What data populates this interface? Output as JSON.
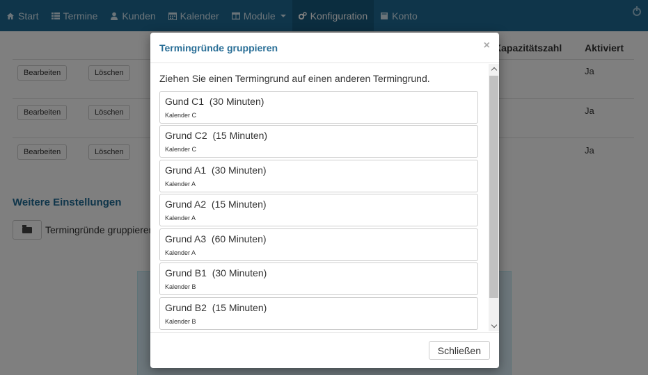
{
  "navbar": {
    "items": [
      {
        "label": "Start",
        "icon": "home-icon"
      },
      {
        "label": "Termine",
        "icon": "list-icon"
      },
      {
        "label": "Kunden",
        "icon": "user-icon"
      },
      {
        "label": "Kalender",
        "icon": "calendar-icon"
      },
      {
        "label": "Module",
        "icon": "grid-icon"
      },
      {
        "label": "Konfiguration",
        "icon": "gears-icon"
      },
      {
        "label": "Konto",
        "icon": "book-icon"
      }
    ],
    "active": "Konfiguration"
  },
  "table": {
    "headers": {
      "capacity": "Kapazitätszahl",
      "activated": "Aktiviert"
    },
    "rows": [
      {
        "edit": "Bearbeiten",
        "delete": "Löschen",
        "activated": "Ja"
      },
      {
        "edit": "Bearbeiten",
        "delete": "Löschen",
        "activated": "Ja"
      },
      {
        "edit": "Bearbeiten",
        "delete": "Löschen",
        "activated": "Ja"
      }
    ]
  },
  "further_settings": {
    "title": "Weitere Einstellungen",
    "group_button_label": "Termingründe gruppieren"
  },
  "modal": {
    "title": "Termingründe gruppieren",
    "close_symbol": "×",
    "intro": "Ziehen Sie einen Termingrund auf einen anderen Termingrund.",
    "reasons": [
      {
        "name": "Gund C1  (30 Minuten)",
        "calendar": "Kalender C"
      },
      {
        "name": "Grund C2  (15 Minuten)",
        "calendar": "Kalender C"
      },
      {
        "name": "Grund A1  (30 Minuten)",
        "calendar": "Kalender A"
      },
      {
        "name": "Grund A2  (15 Minuten)",
        "calendar": "Kalender A"
      },
      {
        "name": "Grund A3  (60 Minuten)",
        "calendar": "Kalender A"
      },
      {
        "name": "Grund B1  (30 Minuten)",
        "calendar": "Kalender B"
      },
      {
        "name": "Grund B2  (15 Minuten)",
        "calendar": "Kalender B"
      }
    ],
    "footer_button": "Schließen"
  }
}
